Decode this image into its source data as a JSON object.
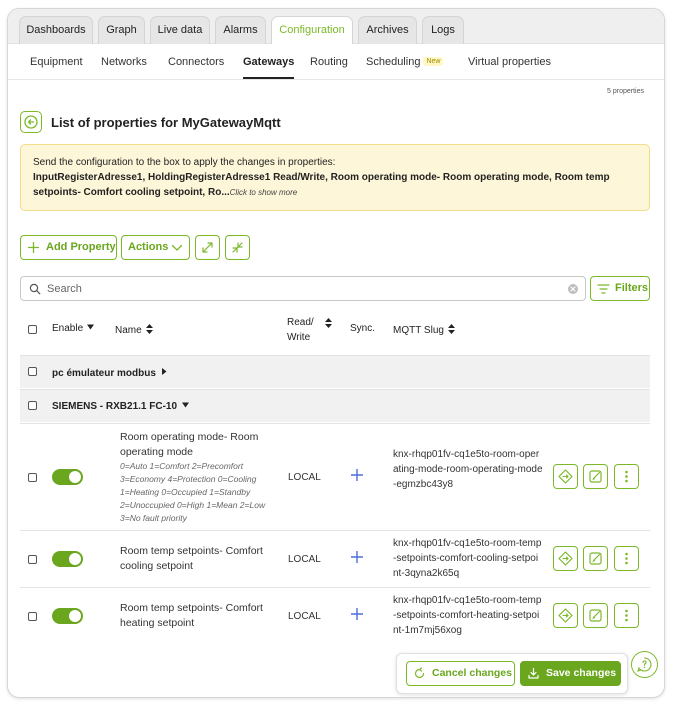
{
  "tabs": [
    {
      "label": "Dashboards",
      "active": false
    },
    {
      "label": "Graph",
      "active": false
    },
    {
      "label": "Live data",
      "active": false
    },
    {
      "label": "Alarms",
      "active": false
    },
    {
      "label": "Configuration",
      "active": true
    },
    {
      "label": "Archives",
      "active": false
    },
    {
      "label": "Logs",
      "active": false
    }
  ],
  "subnav": [
    {
      "label": "Equipment"
    },
    {
      "label": "Networks"
    },
    {
      "label": "Connectors"
    },
    {
      "label": "Gateways",
      "active": true
    },
    {
      "label": "Routing"
    },
    {
      "label": "Scheduling",
      "badge": "New"
    },
    {
      "label": "Virtual properties"
    }
  ],
  "properties_count": "5 properties",
  "page_title": "List of properties for MyGatewayMqtt",
  "notice": {
    "intro": "Send the configuration to the box to apply the changes in properties:",
    "list": "InputRegisterAdresse1, HoldingRegisterAdresse1 Read/Write, Room operating mode- Room operating mode, Room temp setpoints- Comfort cooling setpoint, Ro...",
    "more": "Click to show more"
  },
  "toolbar": {
    "add_property": "Add Property",
    "actions": "Actions",
    "filters": "Filters"
  },
  "search": {
    "placeholder": "Search",
    "value": ""
  },
  "columns": {
    "enable": "Enable",
    "name": "Name",
    "read_write_1": "Read/",
    "read_write_2": "Write",
    "sync": "Sync.",
    "mqtt_slug": "MQTT Slug"
  },
  "groups": [
    {
      "label": "pc émulateur modbus",
      "expanded": false
    },
    {
      "label": "SIEMENS - RXB21.1 FC-10",
      "expanded": true
    }
  ],
  "rows": [
    {
      "enabled": true,
      "name": "Room operating mode- Room operating mode",
      "description": "0=Auto 1=Comfort 2=Precomfort 3=Economy 4=Protection 0=Cooling 1=Heating 0=Occupied 1=Standby 2=Unoccupied 0=High 1=Mean 2=Low 3=No fault priority",
      "read_write": "LOCAL",
      "slug": "knx-rhqp01fv-cq1e5to-room-operating-mode-room-operating-mode-egmzbc43y8"
    },
    {
      "enabled": true,
      "name": "Room temp setpoints- Comfort cooling setpoint",
      "description": "",
      "read_write": "LOCAL",
      "slug": "knx-rhqp01fv-cq1e5to-room-temp-setpoints-comfort-cooling-setpoint-3qyna2k65q"
    },
    {
      "enabled": true,
      "name": "Room temp setpoints- Comfort heating setpoint",
      "description": "",
      "read_write": "LOCAL",
      "slug": "knx-rhqp01fv-cq1e5to-room-temp-setpoints-comfort-heating-setpoint-1m7mj56xog"
    }
  ],
  "footer": {
    "cancel": "Cancel changes",
    "save": "Save changes"
  },
  "colors": {
    "accent": "#7bb928",
    "accent_dark": "#6aa61e",
    "notice_bg": "#fdf6d8",
    "sync_plus": "#4a6ed8"
  }
}
